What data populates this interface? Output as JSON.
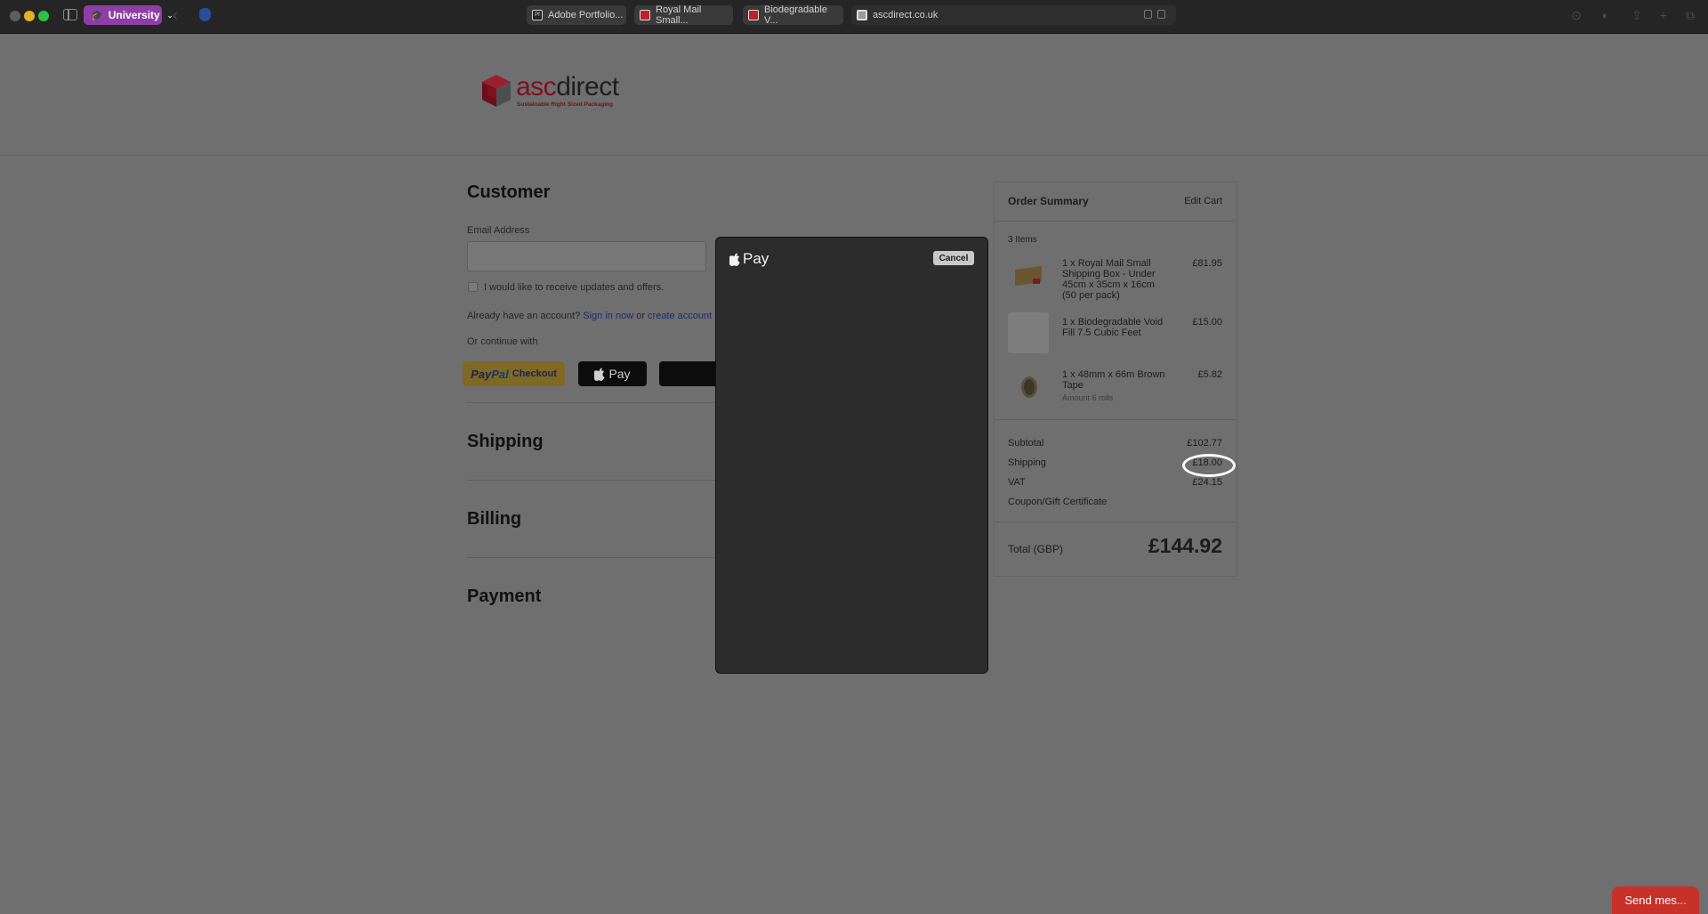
{
  "browser": {
    "profile_label": "University",
    "tabs": [
      {
        "label": "Adobe Portfolio...",
        "favicon": "adobe-favicon"
      },
      {
        "label": "Royal Mail Small...",
        "favicon": "royal-mail-favicon"
      },
      {
        "label": "Biodegradable V...",
        "favicon": "royal-mail-favicon"
      },
      {
        "label": "ascdirect.co.uk",
        "favicon": "ascdirect-favicon",
        "active": true
      }
    ]
  },
  "site": {
    "logo_word_a": "asc",
    "logo_word_b": "direct",
    "logo_tagline": "Sustainable Right Sized Packaging",
    "brand_color": "#7e1020"
  },
  "checkout": {
    "customer_title": "Customer",
    "email_label": "Email Address",
    "email_value": "",
    "newsletter_label": "I would like to receive updates and offers.",
    "account_prefix": "Already have an account?",
    "sign_in_link": "Sign in now",
    "or_text": "or",
    "create_account_link": "create account",
    "continue_with": "Or continue with",
    "paypal_logo_a": "Pay",
    "paypal_logo_b": "Pal",
    "paypal_checkout": "Checkout",
    "applepay_label": "Pay",
    "shipping_title": "Shipping",
    "billing_title": "Billing",
    "payment_title": "Payment"
  },
  "summary": {
    "title": "Order Summary",
    "edit_cart": "Edit Cart",
    "items_count": "3 Items",
    "items": [
      {
        "name": "1 x Royal Mail Small Shipping Box - Under 45cm x 35cm x 16cm (50 per pack)",
        "price": "£81.95",
        "extra": ""
      },
      {
        "name": "1 x Biodegradable Void Fill 7.5 Cubic Feet",
        "price": "£15.00",
        "extra": ""
      },
      {
        "name": "1 x 48mm x 66m Brown Tape",
        "price": "£5.82",
        "extra": "Amount 6 rolls"
      }
    ],
    "subtotal_label": "Subtotal",
    "subtotal_value": "£102.77",
    "shipping_label": "Shipping",
    "shipping_value": "£18.00",
    "vat_label": "VAT",
    "vat_value": "£24.15",
    "coupon_link": "Coupon/Gift Certificate",
    "total_label": "Total (GBP)",
    "total_value": "£144.92"
  },
  "applepay_modal": {
    "title": "Pay",
    "cancel_label": "Cancel"
  },
  "chat": {
    "label": "Send mes..."
  }
}
